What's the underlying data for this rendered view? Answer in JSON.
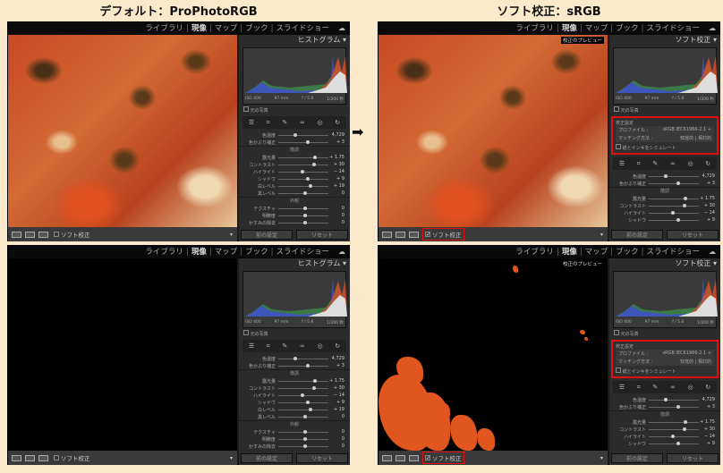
{
  "titles": {
    "left": "デフォルト：ProPhotoRGB",
    "right": "ソフト校正：sRGB"
  },
  "nav": {
    "items": [
      "ライブラリ",
      "現像",
      "マップ",
      "ブック",
      "スライドショー"
    ],
    "active": "現像"
  },
  "histogram_info": [
    "ISO 400",
    "97 mm",
    "f / 5.6",
    "1/200 秒"
  ],
  "original_photo": "元の写真",
  "preview_label": "校正のプレビュー",
  "proof": {
    "title": "校正設定",
    "profile_label": "プロファイル :",
    "profile_value": "sRGB IEC61966-2.1 ÷",
    "matching_label": "マッチング方法 :",
    "matching_options": [
      "知覚的",
      "相対的"
    ],
    "simulate": "紙とインキをシミュレート"
  },
  "buttons": {
    "previous": "前の設定",
    "reset": "リセット"
  },
  "toolbar": {
    "soft_proof": "ソフト校正"
  },
  "colors": {
    "highlight": "#e01010",
    "warning": "#e0561e"
  },
  "panels": [
    {
      "id": "top-left",
      "header": "ヒストグラム ▾",
      "proof": false,
      "soft_proof_checked": false,
      "image": "photo",
      "sliders": [
        {
          "label": "色温度",
          "value": "4,729"
        },
        {
          "label": "色かぶり補正",
          "value": "+ 3"
        },
        {
          "group": "階調"
        },
        {
          "label": "露光量",
          "value": "+ 1.75"
        },
        {
          "label": "コントラスト",
          "value": "+ 30"
        },
        {
          "label": "ハイライト",
          "value": "− 14"
        },
        {
          "label": "シャドウ",
          "value": "+ 9"
        },
        {
          "label": "白レベル",
          "value": "+ 19"
        },
        {
          "label": "黒レベル",
          "value": "0"
        },
        {
          "group": "外観"
        },
        {
          "label": "テクスチャ",
          "value": "0"
        },
        {
          "label": "明瞭度",
          "value": "0"
        },
        {
          "label": "かすみの除去",
          "value": "0"
        }
      ]
    },
    {
      "id": "top-right",
      "header": "ソフト校正 ▾",
      "proof": true,
      "soft_proof_checked": true,
      "image": "photo",
      "sliders": [
        {
          "label": "色温度",
          "value": "4,729"
        },
        {
          "label": "色かぶり補正",
          "value": "+ 3"
        },
        {
          "group": "階調"
        },
        {
          "label": "露光量",
          "value": "+ 1.75"
        },
        {
          "label": "コントラスト",
          "value": "+ 30"
        },
        {
          "label": "ハイライト",
          "value": "− 14"
        },
        {
          "label": "シャドウ",
          "value": "+ 9"
        }
      ]
    },
    {
      "id": "bottom-left",
      "header": "ヒストグラム ▾",
      "proof": false,
      "soft_proof_checked": false,
      "image": "black",
      "sliders": [
        {
          "label": "色温度",
          "value": "4,729"
        },
        {
          "label": "色かぶり補正",
          "value": "+ 3"
        },
        {
          "group": "階調"
        },
        {
          "label": "露光量",
          "value": "+ 1.75"
        },
        {
          "label": "コントラスト",
          "value": "+ 30"
        },
        {
          "label": "ハイライト",
          "value": "− 14"
        },
        {
          "label": "シャドウ",
          "value": "+ 9"
        },
        {
          "label": "白レベル",
          "value": "+ 19"
        },
        {
          "label": "黒レベル",
          "value": "0"
        },
        {
          "group": "外観"
        },
        {
          "label": "テクスチャ",
          "value": "0"
        },
        {
          "label": "明瞭度",
          "value": "0"
        },
        {
          "label": "かすみの除去",
          "value": "0"
        }
      ]
    },
    {
      "id": "bottom-right",
      "header": "ソフト校正 ▾",
      "proof": true,
      "soft_proof_checked": true,
      "image": "gamut",
      "sliders": [
        {
          "label": "色温度",
          "value": "4,729"
        },
        {
          "label": "色かぶり補正",
          "value": "+ 3"
        },
        {
          "group": "階調"
        },
        {
          "label": "露光量",
          "value": "+ 1.75"
        },
        {
          "label": "コントラスト",
          "value": "+ 30"
        },
        {
          "label": "ハイライト",
          "value": "− 14"
        },
        {
          "label": "シャドウ",
          "value": "+ 9"
        }
      ]
    }
  ]
}
